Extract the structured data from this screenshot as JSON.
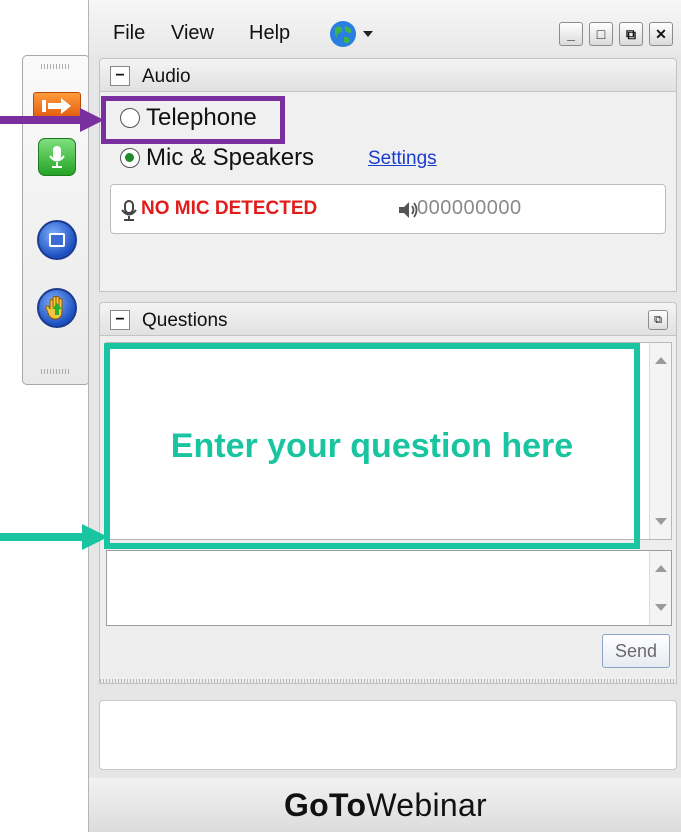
{
  "menu": {
    "file": "File",
    "view": "View",
    "help": "Help"
  },
  "window_controls": {
    "minimize": "_",
    "maximize": "□",
    "popout": "⧉",
    "close": "✕"
  },
  "audio": {
    "title": "Audio",
    "collapse_symbol": "−",
    "telephone_label": "Telephone",
    "mic_label": "Mic & Speakers",
    "selected": "mic",
    "settings_link": "Settings",
    "mic_status": "NO MIC DETECTED",
    "speaker_level": "000000000"
  },
  "questions": {
    "title": "Questions",
    "collapse_symbol": "−",
    "popout_symbol": "⧉",
    "input_hint": "Enter your question here",
    "send_label": "Send"
  },
  "brand": {
    "go_to": "GoTo",
    "webinar": "Webinar"
  },
  "colors": {
    "annotation_purple": "#7a2f9e",
    "annotation_teal": "#19c4a0",
    "mic_status_red": "#e21b1b",
    "link_blue": "#1a3ccf"
  }
}
